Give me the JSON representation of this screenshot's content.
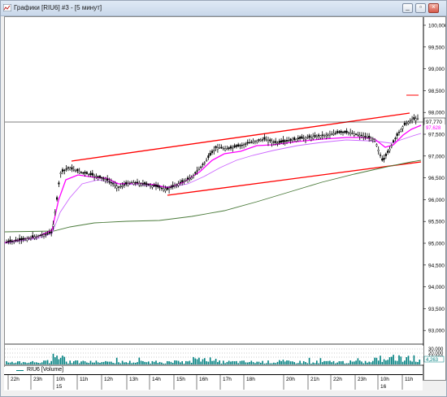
{
  "window": {
    "title": "Графики [RIU6] #3 - [5 минут]",
    "controls": [
      "minimize",
      "restore",
      "close"
    ]
  },
  "price_axis": {
    "labels": [
      "100,000",
      "99,500",
      "99,000",
      "98,500",
      "98,000",
      "97,500",
      "97,000",
      "96,500",
      "96,000",
      "95,500",
      "95,000",
      "94,500",
      "94,000",
      "93,500",
      "93,000"
    ],
    "current_price": "97,770",
    "ma_value": "97,628"
  },
  "volume_axis": {
    "labels": [
      "30,000",
      "20,000",
      "10,000"
    ],
    "current": "4,263"
  },
  "legend": {
    "series_label": "RIU6 [Volume]"
  },
  "time_axis": {
    "labels": [
      "22h",
      "23h",
      "10h",
      "11h",
      "12h",
      "13h",
      "14h",
      "15h",
      "16h",
      "17h",
      "18h",
      "20h",
      "21h",
      "22h",
      "23h",
      "10h",
      "11h"
    ],
    "day_labels": [
      "15",
      "16"
    ]
  },
  "colors": {
    "price_bars": "#000000",
    "ma_fast": "#ff00ff",
    "ma_mid": "#cc66ff",
    "ma_slow": "#4a7a3a",
    "channel": "#ff0000",
    "volume_bars": "#008080",
    "crosshair": "#000000"
  }
}
